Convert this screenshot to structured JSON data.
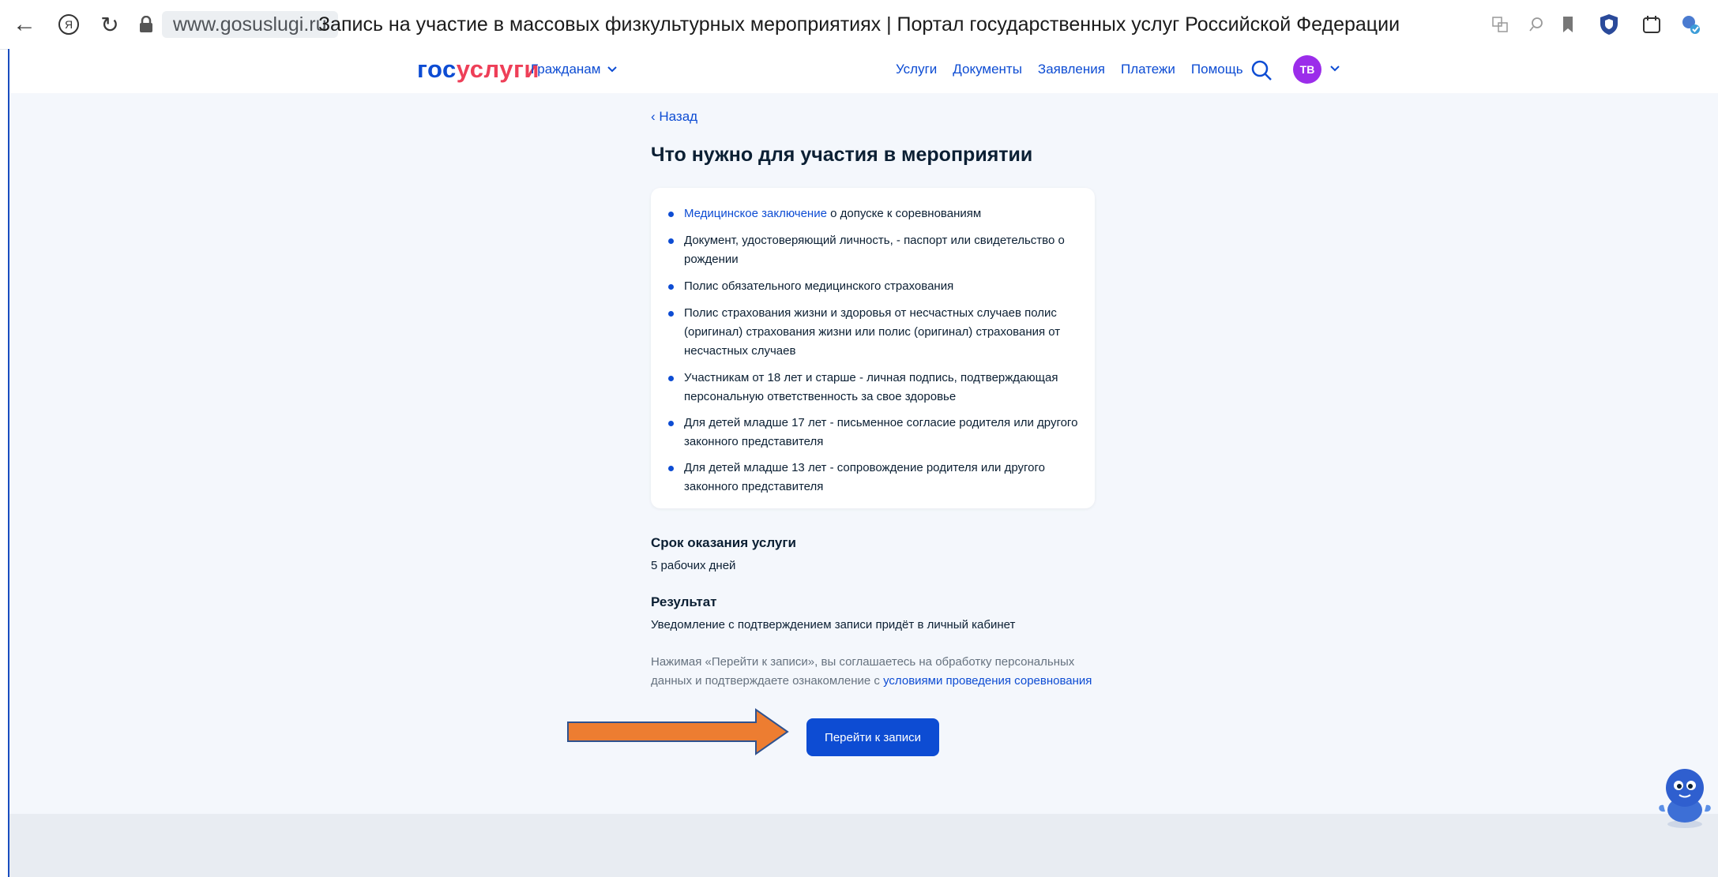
{
  "browser": {
    "url": "www.gosuslugi.ru",
    "tab_title": "Запись на участие в массовых физкультурных мероприятиях | Портал государственных услуг Российской Федерации"
  },
  "header": {
    "logo_part1": "гос",
    "logo_part2": "услуги",
    "audience": "Гражданам",
    "nav": [
      "Услуги",
      "Документы",
      "Заявления",
      "Платежи",
      "Помощь"
    ],
    "avatar_initials": "ТВ"
  },
  "page": {
    "back": "‹ Назад",
    "title": "Что нужно для участия в мероприятии",
    "requirements": {
      "item1_link": "Медицинское заключение",
      "item1_rest": " о допуске к соревнованиям",
      "item2": "Документ, удостоверяющий личность, - паспорт или свидетельство о рождении",
      "item3": "Полис обязательного медицинского страхования",
      "item4": "Полис страхования жизни и здоровья от несчастных случаев полис (оригинал) страхования жизни или полис (оригинал) страхования от несчастных случаев",
      "item5": "Участникам от 18 лет и старше - личная подпись, подтверждающая персональную ответственность за свое здоровье",
      "item6": "Для детей младше 17 лет - письменное согласие родителя или другого законного представителя",
      "item7": "Для детей младше 13 лет - сопровождение родителя или другого законного представителя"
    },
    "term_heading": "Срок оказания услуги",
    "term_value": "5 рабочих дней",
    "result_heading": "Результат",
    "result_value": "Уведомление с подтверждением записи придёт в личный кабинет",
    "consent_text": "Нажимая «Перейти к записи», вы соглашаетесь на обработку персональных данных и подтверждаете ознакомление с ",
    "consent_link": "условиями проведения соревнования",
    "cta": "Перейти к записи"
  },
  "colors": {
    "primary": "#0d4cd3",
    "logo_accent": "#ee3f58",
    "avatar": "#9b2dea",
    "arrow_fill": "#ed7d31",
    "arrow_stroke": "#2f528f",
    "background": "#f4f7fc"
  }
}
